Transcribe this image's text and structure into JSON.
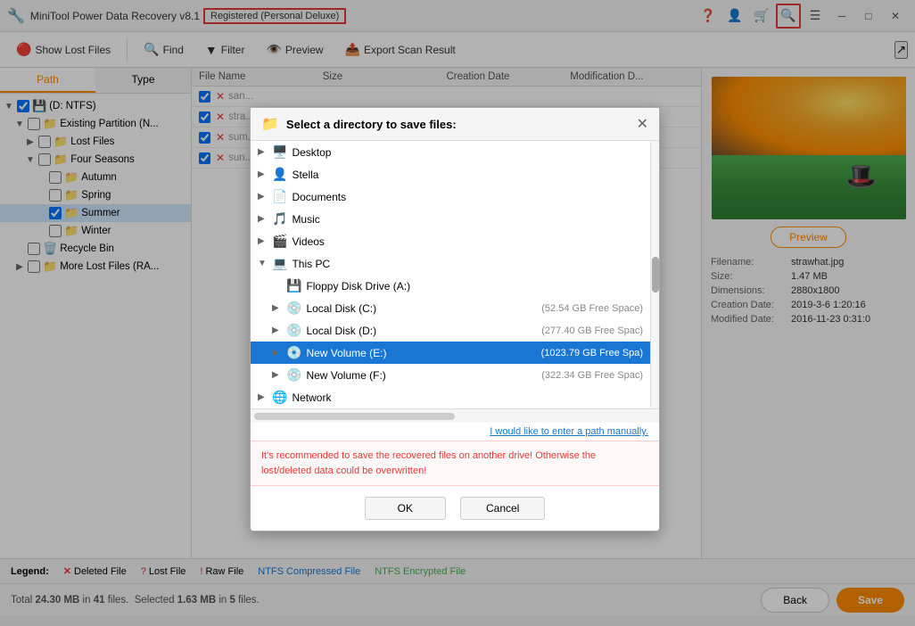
{
  "app": {
    "title": "MiniTool Power Data Recovery v8.1",
    "registered_badge": "Registered (Personal Deluxe)",
    "share_icon": "↗"
  },
  "toolbar": {
    "show_lost_files": "Show Lost Files",
    "find": "Find",
    "filter": "Filter",
    "preview": "Preview",
    "export_scan_result": "Export Scan Result"
  },
  "left_panel": {
    "tab_path": "Path",
    "tab_type": "Type",
    "tree": [
      {
        "id": "root",
        "label": "(D: NTFS)",
        "indent": 0,
        "expanded": true,
        "checked": "indeterminate",
        "icon": "💾"
      },
      {
        "id": "existing",
        "label": "Existing Partition (N...",
        "indent": 1,
        "expanded": true,
        "checked": "indeterminate",
        "icon": "📁"
      },
      {
        "id": "lost_files",
        "label": "Lost Files",
        "indent": 2,
        "expanded": false,
        "checked": false,
        "icon": "📁"
      },
      {
        "id": "four_seasons",
        "label": "Four Seasons",
        "indent": 2,
        "expanded": true,
        "checked": "indeterminate",
        "icon": "📁"
      },
      {
        "id": "autumn",
        "label": "Autumn",
        "indent": 3,
        "checked": false,
        "icon": "📁"
      },
      {
        "id": "spring",
        "label": "Spring",
        "indent": 3,
        "checked": false,
        "icon": "📁"
      },
      {
        "id": "summer",
        "label": "Summer",
        "indent": 3,
        "checked": true,
        "icon": "📁"
      },
      {
        "id": "winter",
        "label": "Winter",
        "indent": 3,
        "checked": false,
        "icon": "📁"
      },
      {
        "id": "recycle_bin",
        "label": "Recycle Bin",
        "indent": 1,
        "checked": false,
        "icon": "🗑️"
      },
      {
        "id": "more_lost",
        "label": "More Lost Files (RA...",
        "indent": 1,
        "checked": false,
        "icon": "📁"
      }
    ]
  },
  "table": {
    "headers": [
      "File Name",
      "Size",
      "Creation Date",
      "Modification D..."
    ]
  },
  "preview": {
    "button_label": "Preview",
    "filename_label": "Filename:",
    "filename_value": "strawhat.jpg",
    "size_label": "Size:",
    "size_value": "1.47 MB",
    "dimensions_label": "Dimensions:",
    "dimensions_value": "2880x1800",
    "creation_date_label": "Creation Date:",
    "creation_date_value": "2019-3-6 1:20:16",
    "modified_date_label": "Modified Date:",
    "modified_date_value": "2016-11-23 0:31:0"
  },
  "dialog": {
    "title": "Select a directory to save files:",
    "folders": [
      {
        "label": "Desktop",
        "indent": 0,
        "expanded": false,
        "icon": "🖥️",
        "space": ""
      },
      {
        "label": "Stella",
        "indent": 0,
        "expanded": false,
        "icon": "👤",
        "space": ""
      },
      {
        "label": "Documents",
        "indent": 0,
        "expanded": false,
        "icon": "📄",
        "space": ""
      },
      {
        "label": "Music",
        "indent": 0,
        "expanded": false,
        "icon": "🎵",
        "space": ""
      },
      {
        "label": "Videos",
        "indent": 0,
        "expanded": false,
        "icon": "🎬",
        "space": ""
      },
      {
        "label": "This PC",
        "indent": 0,
        "expanded": true,
        "icon": "💻",
        "space": ""
      },
      {
        "label": "Floppy Disk Drive (A:)",
        "indent": 1,
        "expanded": false,
        "icon": "💾",
        "space": ""
      },
      {
        "label": "Local Disk (C:)",
        "indent": 1,
        "expanded": false,
        "icon": "💿",
        "space": "(52.54 GB Free Space)"
      },
      {
        "label": "Local Disk (D:)",
        "indent": 1,
        "expanded": false,
        "icon": "💿",
        "space": "(277.40 GB Free Spac)"
      },
      {
        "label": "New Volume (E:)",
        "indent": 1,
        "expanded": false,
        "icon": "💿",
        "space": "(1023.79 GB Free Spa)",
        "selected": true
      },
      {
        "label": "New Volume (F:)",
        "indent": 1,
        "expanded": false,
        "icon": "💿",
        "space": "(322.34 GB Free Spac)"
      },
      {
        "label": "Network",
        "indent": 0,
        "expanded": false,
        "icon": "🌐",
        "space": ""
      }
    ],
    "manual_path_link": "I would like to enter a path manually.",
    "warning": "It's recommended to save the recovered files on another drive! Otherwise the lost/deleted data could be overwritten!",
    "ok_label": "OK",
    "cancel_label": "Cancel"
  },
  "legend": {
    "deleted_file_icon": "✕",
    "deleted_file_label": "Deleted File",
    "lost_file_icon": "?",
    "lost_file_label": "Lost File",
    "raw_file_icon": "!",
    "raw_file_label": "Raw File",
    "ntfs_compressed_label": "NTFS Compressed File",
    "ntfs_encrypted_label": "NTFS Encrypted File"
  },
  "status_bar": {
    "total_text": "Total",
    "total_size": "24.30 MB",
    "total_in": "in",
    "total_files": "41",
    "total_files_label": "files.",
    "selected_text": "Selected",
    "selected_size": "1.63 MB",
    "selected_in": "in",
    "selected_files": "5",
    "selected_files_label": "files.",
    "back_label": "Back",
    "save_label": "Save"
  }
}
